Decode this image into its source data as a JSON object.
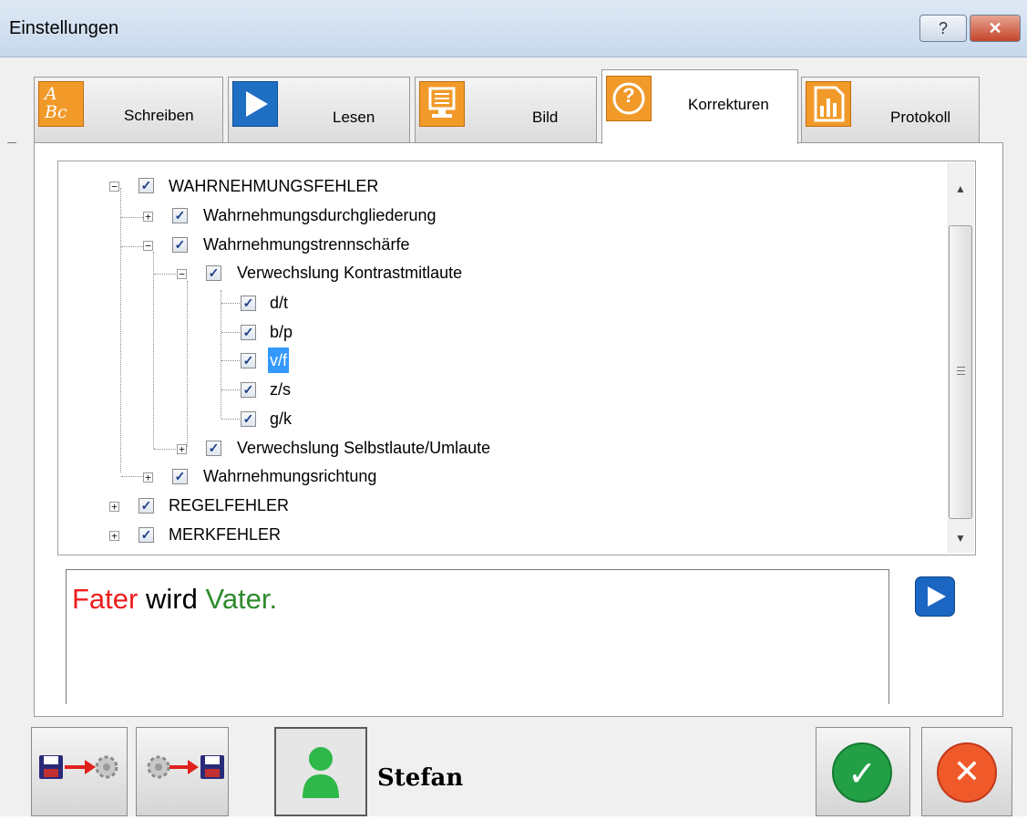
{
  "window": {
    "title": "Einstellungen",
    "help_glyph": "?",
    "close_glyph": "✕"
  },
  "tabs": [
    {
      "label": "Schreiben",
      "icon": "abc-icon",
      "icon_text": "A Bc",
      "active": false
    },
    {
      "label": "Lesen",
      "icon": "play-icon",
      "active": false
    },
    {
      "label": "Bild",
      "icon": "monitor-icon",
      "active": false
    },
    {
      "label": "Korrekturen",
      "icon": "question-icon",
      "icon_text": "?",
      "active": true
    },
    {
      "label": "Protokoll",
      "icon": "bar-chart-icon",
      "active": false
    }
  ],
  "tree": {
    "nodes": [
      {
        "label": "WAHRNEHMUNGSFEHLER",
        "level": 0,
        "expander": "−",
        "checked": true
      },
      {
        "label": "Wahrnehmungsdurchgliederung",
        "level": 1,
        "expander": "+",
        "checked": true
      },
      {
        "label": "Wahrnehmungstrennschärfe",
        "level": 1,
        "expander": "−",
        "checked": true
      },
      {
        "label": "Verwechslung Kontrastmitlaute",
        "level": 2,
        "expander": "−",
        "checked": true
      },
      {
        "label": "d/t",
        "level": 3,
        "checked": true
      },
      {
        "label": "b/p",
        "level": 3,
        "checked": true
      },
      {
        "label": "v/f",
        "level": 3,
        "checked": true,
        "selected": true
      },
      {
        "label": "z/s",
        "level": 3,
        "checked": true
      },
      {
        "label": "g/k",
        "level": 3,
        "checked": true
      },
      {
        "label": "Verwechslung Selbstlaute/Umlaute",
        "level": 2,
        "expander": "+",
        "checked": true
      },
      {
        "label": "Wahrnehmungsrichtung",
        "level": 1,
        "expander": "+",
        "checked": true
      },
      {
        "label": "REGELFEHLER",
        "level": 0,
        "expander": "+",
        "checked": true
      },
      {
        "label": "MERKFEHLER",
        "level": 0,
        "expander": "+",
        "checked": true
      }
    ],
    "check_glyph": "✓",
    "scroll_up": "▲",
    "scroll_down": "▼"
  },
  "preview": {
    "wrong_word": "Fater",
    "middle": " wird ",
    "right_word": "Vater.",
    "wrong_color": "#ee1c1c",
    "right_color": "#2e8b2e"
  },
  "footer": {
    "user_name": "Stefan",
    "ok_glyph": "✓",
    "cancel_glyph": "✕"
  }
}
